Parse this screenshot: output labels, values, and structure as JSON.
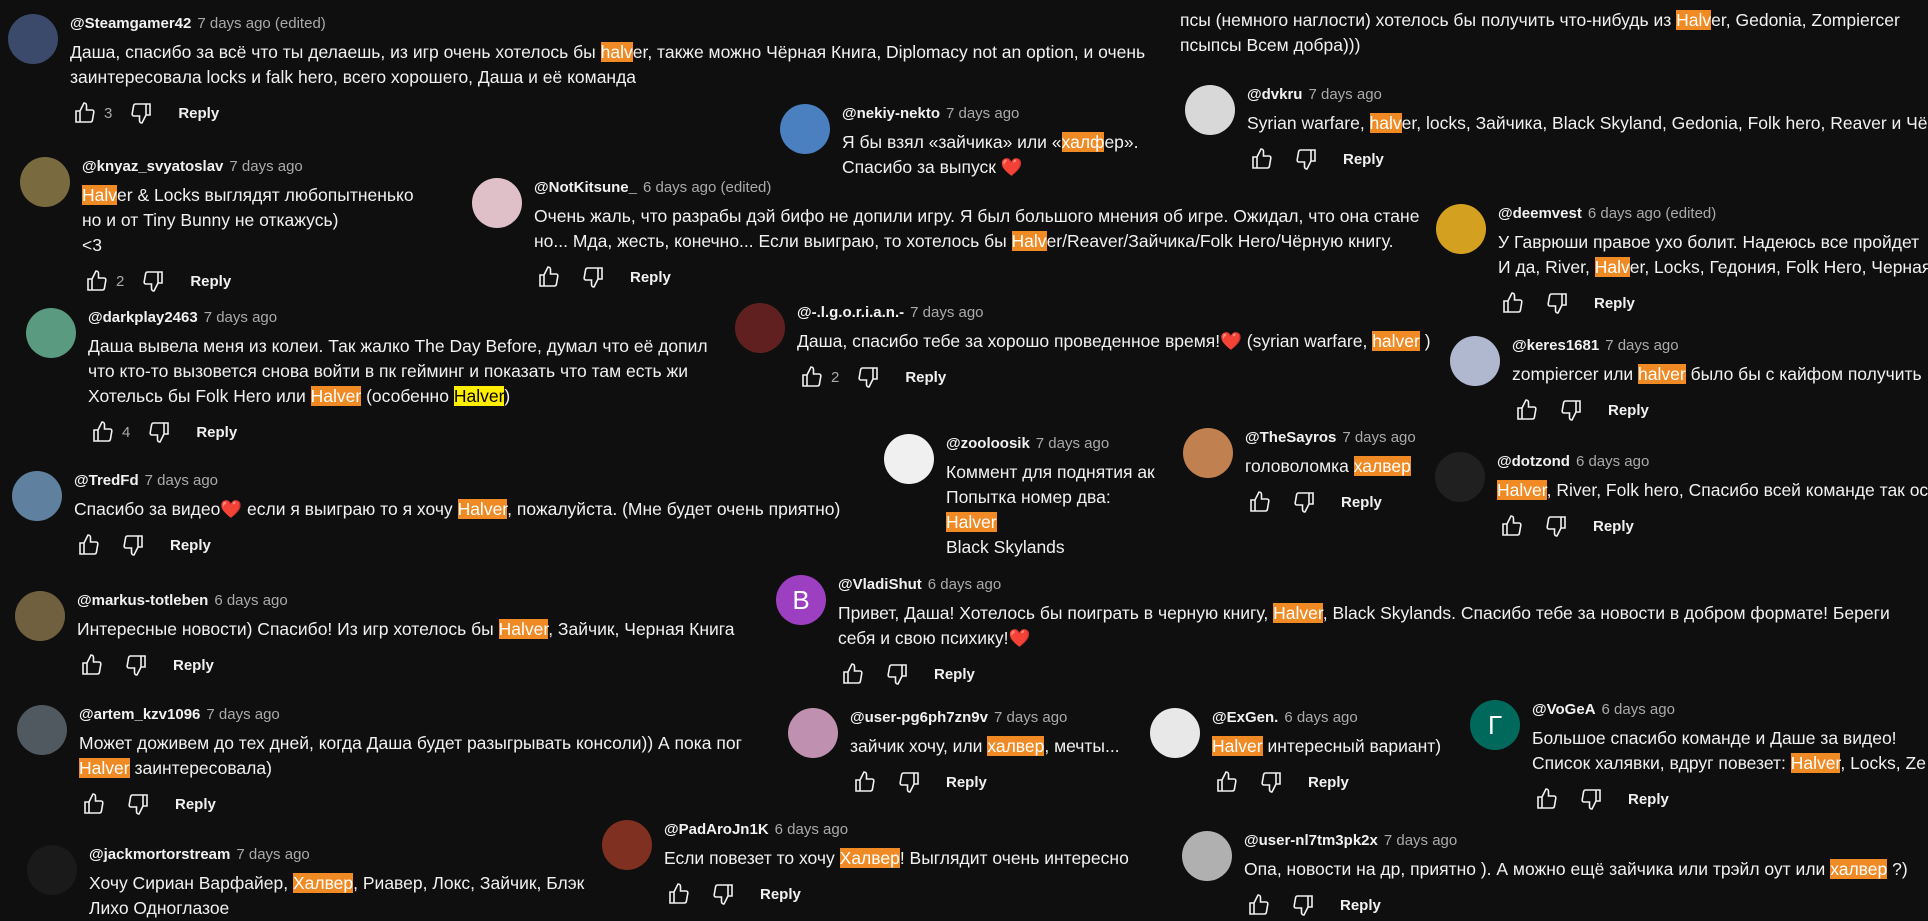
{
  "reply_label": "Reply",
  "highlight_color": "#f08a24",
  "highlight_alt_color": "#ffee00",
  "partial_top": {
    "line1": [
      "псы (немного наглости) хотелось бы получить что-нибудь из ",
      {
        "hl": "Halv"
      },
      "er, Gedonia, Zompiercer"
    ],
    "line2": [
      "псыпсы Всем добра)))"
    ]
  },
  "comments": [
    {
      "id": "steamgamer",
      "author": "@Steamgamer42",
      "meta": "7 days ago (edited)",
      "avatar_color": "#3b4a6b",
      "avatar_letter": "",
      "lines": [
        [
          "Даша, спасибо за всё что ты делаешь, из игр очень хотелось бы ",
          {
            "hl": "halv"
          },
          "er, также можно Чёрная Книга, Diplomacy not an option, и очень"
        ],
        [
          "заинтересовала locks и falk hero, всего хорошего, Даша и её команда"
        ]
      ],
      "likes": "3"
    },
    {
      "id": "nekiy",
      "author": "@nekiy-nekto",
      "meta": "7 days ago",
      "avatar_color": "#4a7fc0",
      "avatar_letter": "",
      "lines": [
        [
          "Я бы взял «зайчика» или «",
          {
            "hl": "халф"
          },
          "ер»."
        ],
        [
          "Спасибо за выпуск ❤️"
        ]
      ],
      "likes": ""
    },
    {
      "id": "dvkru",
      "author": "@dvkru",
      "meta": "7 days ago",
      "avatar_color": "#d8d8d8",
      "avatar_letter": "",
      "lines": [
        [
          "Syrian warfare, ",
          {
            "hl": "halv"
          },
          "er, locks, Зайчика, Black Skyland, Gedonia, Folk hero, Reaver и Чёрную"
        ]
      ],
      "likes": ""
    },
    {
      "id": "knyaz",
      "author": "@knyaz_svyatoslav",
      "meta": "7 days ago",
      "avatar_color": "#7a6a40",
      "avatar_letter": "",
      "lines": [
        [
          {
            "hl": "Halv"
          },
          "er & Locks выглядят любопытненько"
        ],
        [
          "но и от Tiny Bunny не откажусь)"
        ],
        [
          "<3"
        ]
      ],
      "likes": "2"
    },
    {
      "id": "notkitsune",
      "author": "@NotKitsune_",
      "meta": "6 days ago (edited)",
      "avatar_color": "#e0c0c8",
      "avatar_letter": "",
      "lines": [
        [
          "Очень жаль, что разрабы дэй бифо не допили игру. Я был большого мнения об игре. Ожидал, что она стане"
        ],
        [
          "но... Мда, жесть, конечно... Если выиграю, то хотелось бы ",
          {
            "hl": "Halv"
          },
          "er/Reaver/Зайчика/Folk Hero/Чёрную книгу."
        ]
      ],
      "likes": ""
    },
    {
      "id": "deemvest",
      "author": "@deemvest",
      "meta": "6 days ago (edited)",
      "avatar_color": "#d4a020",
      "avatar_letter": "",
      "lines": [
        [
          "У Гаврюши правое ухо болит. Надеюсь все пройдет"
        ],
        [
          "И да, River, ",
          {
            "hl": "Halv"
          },
          "er, Locks, Гедония, Folk Hero, Черная"
        ]
      ],
      "likes": ""
    },
    {
      "id": "darkplay",
      "author": "@darkplay2463",
      "meta": "7 days ago",
      "avatar_color": "#5a9a80",
      "avatar_letter": "",
      "lines": [
        [
          "Даша вывела меня из колеи. Так жалко The Day Before, думал что её допил"
        ],
        [
          "что кто-то вызовется снова войти в пк гейминг и показать что там есть жи"
        ],
        [
          "Хотельсь бы Folk Hero или ",
          {
            "hl": "Halver"
          },
          " (особенно ",
          {
            "hly": "Halver"
          },
          ")"
        ]
      ],
      "likes": "4"
    },
    {
      "id": "igorian",
      "author": "@-.l.g.o.r.i.a.n.-",
      "meta": "7 days ago",
      "avatar_color": "#602020",
      "avatar_letter": "",
      "lines": [
        [
          "Даша, спасибо тебе за хорошо проведенное время!❤️ (syrian warfare, ",
          {
            "hl": "halver"
          },
          " )"
        ]
      ],
      "likes": "2"
    },
    {
      "id": "keres",
      "author": "@keres1681",
      "meta": "7 days ago",
      "avatar_color": "#b0b8d0",
      "avatar_letter": "",
      "lines": [
        [
          "zompiercer или ",
          {
            "hl": "halver"
          },
          " было бы с кайфом получить"
        ]
      ],
      "likes": ""
    },
    {
      "id": "zooloosik",
      "author": "@zooloosik",
      "meta": "7 days ago",
      "avatar_color": "#f0f0f0",
      "avatar_letter": "",
      "lines": [
        [
          "Коммент для поднятия ак"
        ],
        [
          "Попытка номер два:"
        ],
        [
          {
            "hl": "Halver"
          }
        ],
        [
          "Black Skylands"
        ]
      ],
      "likes": "",
      "no_actions": true
    },
    {
      "id": "thesayros",
      "author": "@TheSayros",
      "meta": "7 days ago",
      "avatar_color": "#c08050",
      "avatar_letter": "",
      "lines": [
        [
          "головоломка ",
          {
            "hl": "халвер"
          }
        ]
      ],
      "likes": ""
    },
    {
      "id": "dotzond",
      "author": "@dotzond",
      "meta": "6 days ago",
      "avatar_color": "#202020",
      "avatar_letter": "",
      "lines": [
        [
          {
            "hl": "Halver"
          },
          ", River, Folk hero, Спасибо всей команде так ост"
        ]
      ],
      "likes": ""
    },
    {
      "id": "tredfd",
      "author": "@TredFd",
      "meta": "7 days ago",
      "avatar_color": "#6080a0",
      "avatar_letter": "",
      "lines": [
        [
          "Спасибо за видео❤️  если я выиграю то я хочу ",
          {
            "hl": "Halver"
          },
          ", пожалуйста. (Мне будет очень приятно)"
        ]
      ],
      "likes": ""
    },
    {
      "id": "vladishut",
      "author": "@VladiShut",
      "meta": "6 days ago",
      "avatar_color": "#9c3fc0",
      "avatar_letter": "B",
      "lines": [
        [
          "Привет, Даша! Хотелось бы поиграть в черную книгу, ",
          {
            "hl": "Halver"
          },
          ", Black Skylands. Спасибо тебе за новости в добром формате! Береги"
        ],
        [
          "себя и свою психику!❤️"
        ]
      ],
      "likes": ""
    },
    {
      "id": "markus",
      "author": "@markus-totleben",
      "meta": "6 days ago",
      "avatar_color": "#706040",
      "avatar_letter": "",
      "lines": [
        [
          "Интересные новости) Спасибо! Из игр хотелось бы ",
          {
            "hl": "Halver"
          },
          ", Зайчик, Черная Книга"
        ]
      ],
      "likes": ""
    },
    {
      "id": "artem",
      "author": "@artem_kzv1096",
      "meta": "7 days ago",
      "avatar_color": "#505860",
      "avatar_letter": "",
      "lines": [
        [
          "Может доживем до тех дней, когда Даша будет разыгрывать консоли)) А пока пог"
        ],
        [
          {
            "hl": "Halver"
          },
          " заинтересовала)"
        ]
      ],
      "likes": ""
    },
    {
      "id": "userpg",
      "author": "@user-pg6ph7zn9v",
      "meta": "7 days ago",
      "avatar_color": "#c090b0",
      "avatar_letter": "",
      "lines": [
        [
          "зайчик хочу, или ",
          {
            "hl": "халвер"
          },
          ", мечты..."
        ]
      ],
      "likes": ""
    },
    {
      "id": "exgen",
      "author": "@ExGen.",
      "meta": "6 days ago",
      "avatar_color": "#e8e8e8",
      "avatar_letter": "",
      "lines": [
        [
          {
            "hl": "Halver"
          },
          " интересный вариант)"
        ]
      ],
      "likes": ""
    },
    {
      "id": "vogea",
      "author": "@VoGeA",
      "meta": "6 days ago",
      "avatar_color": "#00695c",
      "avatar_letter": "Г",
      "lines": [
        [
          "Большое спасибо команде и Даше за видео!"
        ],
        [
          "Список халявки, вдруг повезет: ",
          {
            "hl": "Halver"
          },
          ", Locks, Ze"
        ]
      ],
      "likes": ""
    },
    {
      "id": "padaro",
      "author": "@PadAroJn1K",
      "meta": "6 days ago",
      "avatar_color": "#803020",
      "avatar_letter": "",
      "lines": [
        [
          "Если повезет то хочу  ",
          {
            "hl": "Халвер"
          },
          "! Выглядит очень интересно"
        ]
      ],
      "likes": ""
    },
    {
      "id": "usernl",
      "author": "@user-nl7tm3pk2x",
      "meta": "7 days ago",
      "avatar_color": "#b0b0b0",
      "avatar_letter": "",
      "lines": [
        [
          "Опа, новости на др, приятно ). А можно ещё зайчика или трэйл оут или ",
          {
            "hl": "халвер"
          },
          " ?)"
        ]
      ],
      "likes": ""
    },
    {
      "id": "jackmortor",
      "author": "@jackmortorstream",
      "meta": "7 days ago",
      "avatar_color": "#1a1a1a",
      "avatar_letter": "",
      "lines": [
        [
          "Хочу Сириан Варфайер, ",
          {
            "hl": "Халвер"
          },
          ", Риавер, Локс, Зайчик, Блэк"
        ],
        [
          "Лихо Одноглазое"
        ]
      ],
      "likes": "",
      "no_actions": true
    }
  ]
}
